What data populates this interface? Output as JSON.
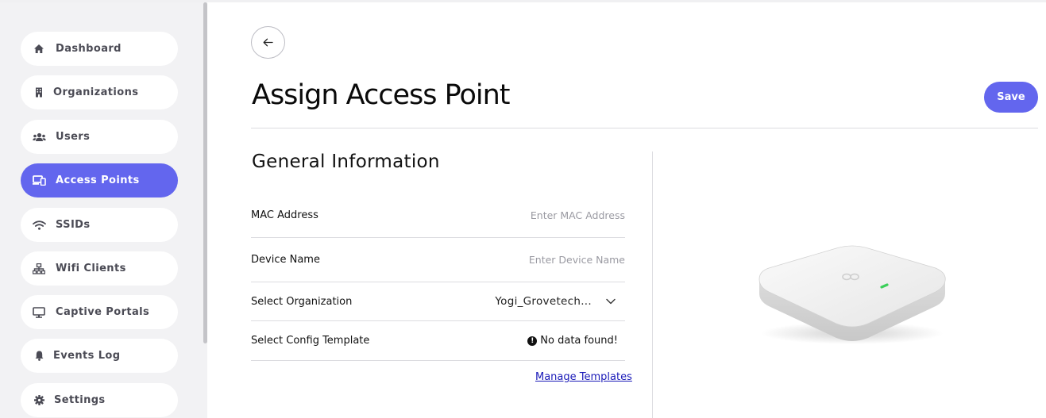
{
  "sidebar": {
    "items": [
      {
        "label": "Dashboard",
        "icon": "home-icon"
      },
      {
        "label": "Organizations",
        "icon": "building-icon"
      },
      {
        "label": "Users",
        "icon": "users-icon"
      },
      {
        "label": "Access Points",
        "icon": "devices-icon",
        "active": true
      },
      {
        "label": "SSIDs",
        "icon": "wifi-icon"
      },
      {
        "label": "Wifi Clients",
        "icon": "network-icon"
      },
      {
        "label": "Captive Portals",
        "icon": "monitor-icon"
      },
      {
        "label": "Events Log",
        "icon": "bell-icon"
      },
      {
        "label": "Settings",
        "icon": "gear-icon"
      }
    ]
  },
  "header": {
    "title": "Assign Access Point",
    "save_label": "Save",
    "back_icon": "arrow-left-icon"
  },
  "form": {
    "section_title": "General Information",
    "mac": {
      "label": "MAC Address",
      "value": "",
      "placeholder": "Enter MAC Address"
    },
    "device_name": {
      "label": "Device Name",
      "value": "",
      "placeholder": "Enter Device Name"
    },
    "organization": {
      "label": "Select Organization",
      "selected": "Yogi_Grovetech..."
    },
    "config_template": {
      "label": "Select Config Template",
      "status": "No data found!"
    },
    "manage_link": "Manage Templates"
  },
  "colors": {
    "accent": "#6366ee",
    "sidebar_bg": "#f2f2f4",
    "link": "#1a1ab8"
  }
}
